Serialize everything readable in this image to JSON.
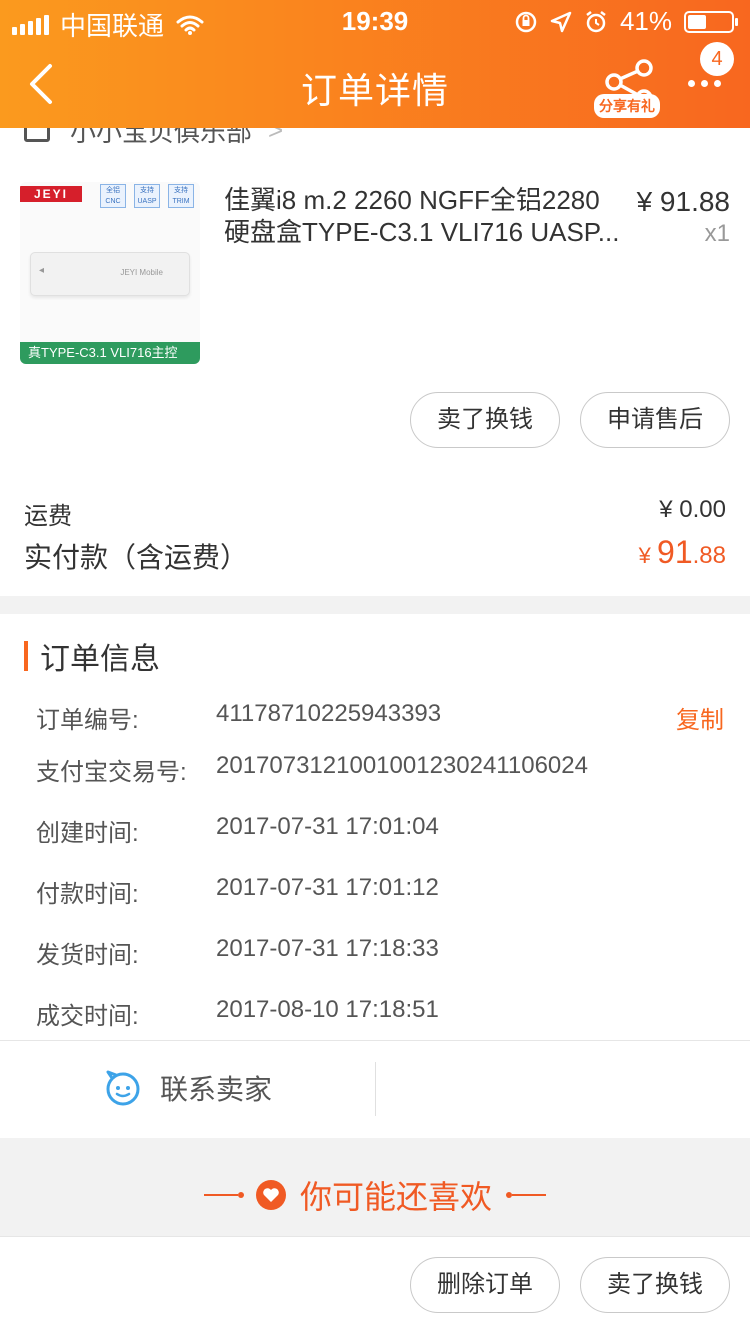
{
  "status_bar": {
    "carrier": "中国联通",
    "time": "19:39",
    "battery": "41%"
  },
  "nav": {
    "title": "订单详情",
    "share_label": "分享有礼",
    "badge": "4"
  },
  "shop": {
    "name": "小小宝贝俱乐部"
  },
  "product": {
    "title": "佳翼i8 m.2 2260 NGFF全铝2280硬盘盒TYPE-C3.1 VLI716 UASP...",
    "price": "¥ 91.88",
    "qty": "x1",
    "image": {
      "brand": "JEYI",
      "tags": [
        "全铝 CNC",
        "支持 UASP",
        "支持 TRIM"
      ],
      "device_logo": "JEYI Mobile",
      "caption": "真TYPE-C3.1 VLI716主控"
    },
    "actions": [
      "卖了换钱",
      "申请售后"
    ]
  },
  "totals": {
    "shipping_label": "运费",
    "shipping_value": "¥ 0.00",
    "paid_label": "实付款（含运费）",
    "paid_currency": "¥ ",
    "paid_int": "91",
    "paid_dec": ".88"
  },
  "order_info": {
    "title": "订单信息",
    "copy_label": "复制",
    "rows": [
      {
        "label": "订单编号:",
        "value": "41178710225943393"
      },
      {
        "label": "支付宝交易号:",
        "value": "2017073121001001230241106024"
      },
      {
        "label": "创建时间:",
        "value": "2017-07-31 17:01:04"
      },
      {
        "label": "付款时间:",
        "value": "2017-07-31 17:01:12"
      },
      {
        "label": "发货时间:",
        "value": "2017-07-31 17:18:33"
      },
      {
        "label": "成交时间:",
        "value": "2017-08-10 17:18:51"
      }
    ]
  },
  "contact": {
    "label": "联系卖家"
  },
  "recommend": {
    "title": "你可能还喜欢"
  },
  "footer": {
    "actions": [
      "删除订单",
      "卖了换钱"
    ]
  },
  "colors": {
    "accent": "#f8671f",
    "header_start": "#fb9a1e",
    "header_end": "#f8671f"
  }
}
